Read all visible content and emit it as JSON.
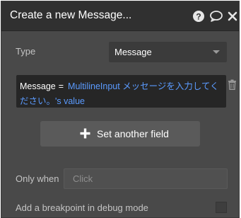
{
  "header": {
    "title": "Create a new Message...",
    "icons": [
      "help-icon",
      "comment-icon",
      "close-icon"
    ]
  },
  "type_row": {
    "label": "Type",
    "selected": "Message"
  },
  "field": {
    "key": "Message",
    "operator": "=",
    "value_line1": "MultilineInput メッセージを入力してく",
    "value_line2": "ださい。's value",
    "delete_icon": "trash-icon"
  },
  "set_field_button": {
    "icon": "plus-icon",
    "label": "Set another field"
  },
  "only_when": {
    "label": "Only when",
    "placeholder": "Click"
  },
  "breakpoint": {
    "label": "Add a breakpoint in debug mode",
    "checked": false
  },
  "colors": {
    "panel_bg": "#494949",
    "header_bg": "#303030",
    "expression_bg": "#262626",
    "dynamic_text": "#5b9bff"
  }
}
